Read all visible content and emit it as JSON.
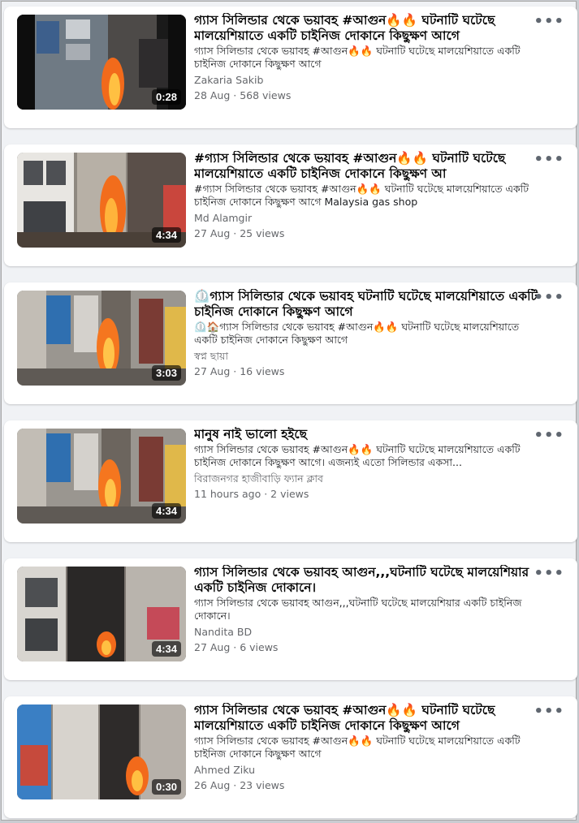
{
  "results": [
    {
      "title": "গ্যাস সিলিন্ডার থেকে ভয়াবহ #আগুন🔥🔥 ঘটনাটি ঘটেছে মালয়েশিয়াতে একটি চাইনিজ দোকানে কিছুক্ষণ আগে",
      "description": "গ্যাস সিলিন্ডার থেকে ভয়াবহ #আগুন🔥🔥 ঘটনাটি ঘটেছে মালয়েশিয়াতে একটি চাইনিজ দোকানে কিছুক্ষণ আগে",
      "author": "Zakaria Sakib",
      "meta": "28 Aug · 568 views",
      "duration": "0:28",
      "more_icon": "•••"
    },
    {
      "title": "#গ্যাস সিলিন্ডার থেকে ভয়াবহ #আগুন🔥🔥 ঘটনাটি ঘটেছে মালয়েশিয়াতে একটি চাইনিজ দোকানে কিছুক্ষণ আ",
      "description": "#গ্যাস সিলিন্ডার থেকে ভয়াবহ #আগুন🔥🔥 ঘটনাটি ঘটেছে মালয়েশিয়াতে একটি চাইনিজ দোকানে কিছুক্ষণ আগে Malaysia gas shop",
      "author": "Md Alamgir",
      "meta": "27 Aug · 25 views",
      "duration": "4:34",
      "more_icon": "•••"
    },
    {
      "title": "⏲️গ্যাস সিলিন্ডার থেকে ভয়াবহ ঘটনাটি ঘটেছে মালয়েশিয়াতে একটি চাইনিজ দোকানে কিছুক্ষণ আগে",
      "description": "⏲️🏠গ্যাস সিলিন্ডার থেকে ভয়াবহ #আগুন🔥🔥 ঘটনাটি ঘটেছে মালয়েশিয়াতে একটি চাইনিজ দোকানে কিছুক্ষণ আগে",
      "author": "স্বপ্ন ছায়া",
      "meta": "27 Aug · 16 views",
      "duration": "3:03",
      "more_icon": "•••"
    },
    {
      "title": "মানুষ নাই ভালো হইছে",
      "description": "গ্যাস সিলিন্ডার থেকে ভয়াবহ #আগুন🔥🔥 ঘটনাটি ঘটেছে মালয়েশিয়াতে একটি চাইনিজ দোকানে কিছুক্ষণ আগে। এজন্যই এতো সিলিন্ডার একসা...",
      "author": "বিরাজনগর হাজীবাড়ি ফ্যান ক্লাব",
      "meta": "11 hours ago · 2 views",
      "duration": "4:34",
      "more_icon": "•••"
    },
    {
      "title": "গ্যাস সিলিন্ডার থেকে ভয়াবহ আগুন,,,ঘটনাটি ঘটেছে মালয়েশিয়ার একটি চাইনিজ দোকানে।",
      "description": "গ্যাস সিলিন্ডার থেকে ভয়াবহ আগুন,,,ঘটনাটি ঘটেছে মালয়েশিয়ার একটি চাইনিজ দোকানে।",
      "author": "Nandita BD",
      "meta": "27 Aug · 6 views",
      "duration": "4:34",
      "more_icon": "•••"
    },
    {
      "title": "গ্যাস সিলিন্ডার থেকে ভয়াবহ #আগুন🔥🔥 ঘটনাটি ঘটেছে মালয়েশিয়াতে একটি চাইনিজ দোকানে কিছুক্ষণ আগে",
      "description": "গ্যাস সিলিন্ডার থেকে ভয়াবহ #আগুন🔥🔥 ঘটনাটি ঘটেছে মালয়েশিয়াতে একটি চাইনিজ দোকানে কিছুক্ষণ আগে",
      "author": "Ahmed Ziku",
      "meta": "26 Aug · 23 views",
      "duration": "0:30",
      "more_icon": "•••"
    }
  ]
}
